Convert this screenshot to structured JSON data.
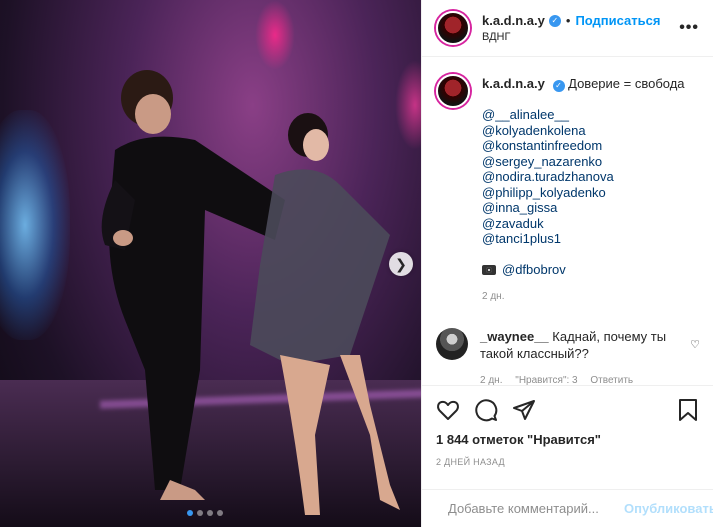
{
  "post": {
    "username": "k.a.d.n.a.y",
    "follow_label": "Подписаться",
    "location": "ВДНГ",
    "caption_text": "Доверие = свобода",
    "mentions": [
      "@__alinalee__",
      "@kolyadenkolena",
      "@konstantinfreedom",
      "@sergey_nazarenko",
      "@nodira.turadzhanova",
      "@philipp_kolyadenko",
      "@inna_gissa",
      "@zavaduk",
      "@tanci1plus1"
    ],
    "camera_credit": "@dfbobrov",
    "caption_age": "2 дн."
  },
  "comment": {
    "username": "_waynee__",
    "text": "Каднай, почему ты такой классный??",
    "age": "2 дн.",
    "likes_label": "\"Нравится\": 3",
    "reply_label": "Ответить"
  },
  "actions": {
    "likes": "1 844 отметок \"Нравится\"",
    "date": "2 ДНЕЙ НАЗАД"
  },
  "add_comment": {
    "placeholder": "Добавьте комментарий...",
    "publish_label": "Опубликовать"
  },
  "carousel": {
    "slide_count": 4,
    "active_index": 0
  },
  "colors": {
    "link": "#0095f6",
    "mention": "#00376b",
    "muted": "#8e8e8e",
    "publish_disabled": "#b2dffc"
  }
}
